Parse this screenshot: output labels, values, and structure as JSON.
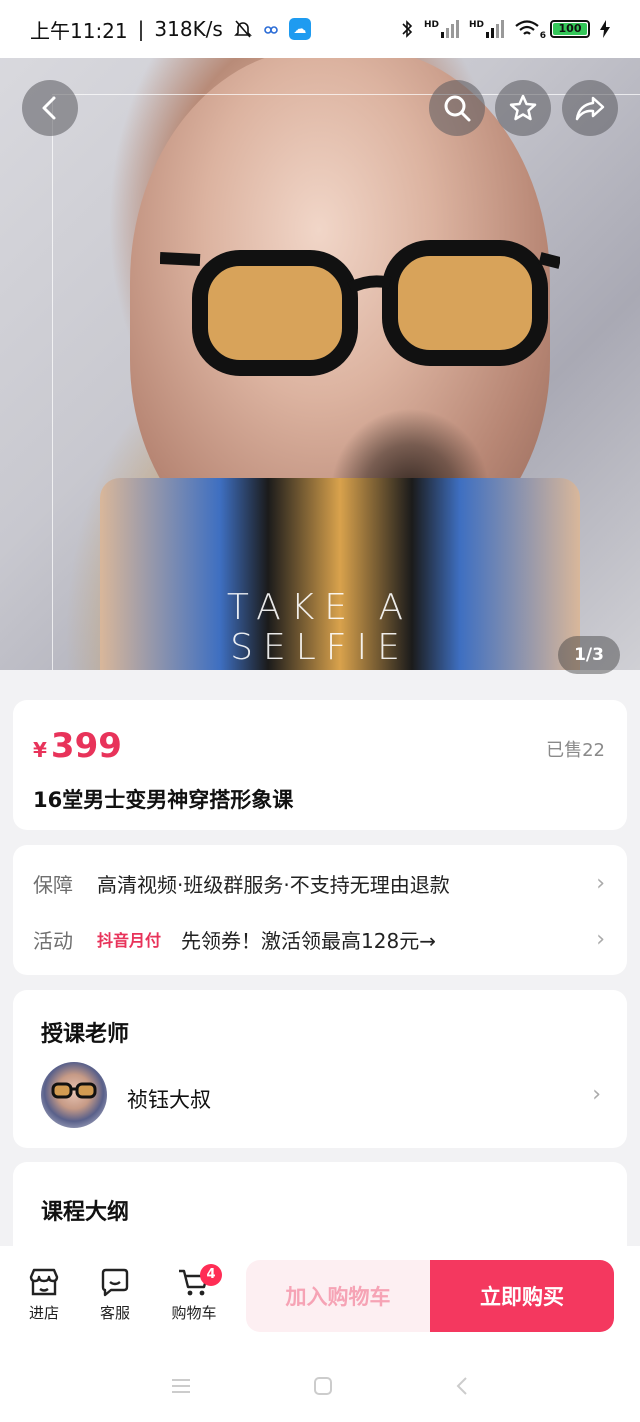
{
  "status_bar": {
    "time": "上午11:21",
    "speed": "318K/s",
    "sim1_label": "HD",
    "sim2_label": "HD",
    "wifi_label": "6",
    "battery": "100"
  },
  "hero": {
    "caption_line1": "TAKE A",
    "caption_line2": "SELFIE",
    "pager": "1/3"
  },
  "product": {
    "currency": "¥",
    "price": "399",
    "sold": "已售22",
    "title": "16堂男士变男神穿搭形象课"
  },
  "guarantee": {
    "label": "保障",
    "value": "高清视频·班级群服务·不支持无理由退款"
  },
  "activity": {
    "label": "活动",
    "tag": "抖音月付",
    "value": "先领券！激活领最高128元→"
  },
  "teacher": {
    "section_title": "授课老师",
    "name": "祯钰大叔"
  },
  "outline": {
    "section_title": "课程大纲"
  },
  "bottom_bar": {
    "store_label": "进店",
    "service_label": "客服",
    "cart_label": "购物车",
    "cart_count": "4",
    "add_to_cart": "加入购物车",
    "buy_now": "立即购买"
  },
  "colors": {
    "accent": "#f4385f",
    "price": "#e8335a"
  }
}
